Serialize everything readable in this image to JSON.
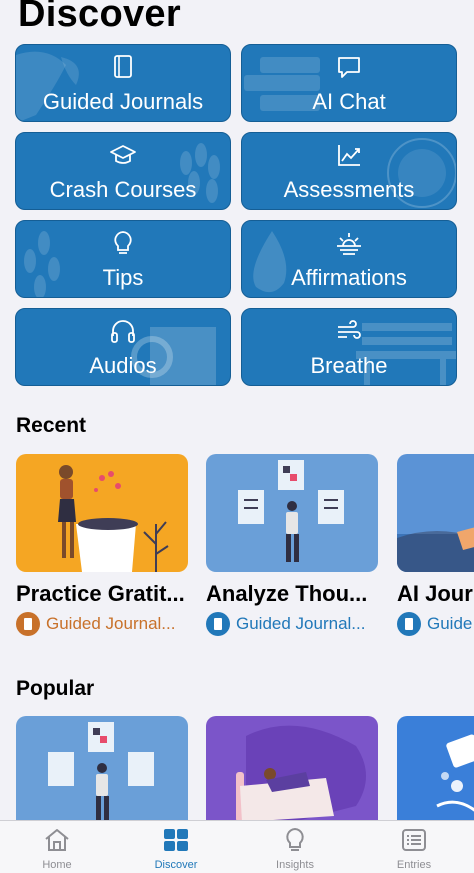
{
  "page_title": "Discover",
  "tiles": [
    {
      "label": "Guided Journals",
      "icon": "book-icon"
    },
    {
      "label": "AI Chat",
      "icon": "chat-bubble-icon"
    },
    {
      "label": "Crash Courses",
      "icon": "graduation-cap-icon"
    },
    {
      "label": "Assessments",
      "icon": "chart-trend-icon"
    },
    {
      "label": "Tips",
      "icon": "lightbulb-icon"
    },
    {
      "label": "Affirmations",
      "icon": "sunrise-icon"
    },
    {
      "label": "Audios",
      "icon": "headphones-icon"
    },
    {
      "label": "Breathe",
      "icon": "wind-icon"
    }
  ],
  "recent": {
    "title": "Recent",
    "cards": [
      {
        "title": "Practice Gratit...",
        "category": "Guided Journal...",
        "category_color": "#c8712a",
        "thumb_color": "#f5a623"
      },
      {
        "title": "Analyze Thou...",
        "category": "Guided Journal...",
        "category_color": "#2178b9",
        "thumb_color": "#6a9fd8"
      },
      {
        "title": "AI Journ",
        "category": "Guide",
        "category_color": "#2178b9",
        "thumb_color": "#5b93d6"
      }
    ]
  },
  "popular": {
    "title": "Popular",
    "thumb_colors": [
      "#6a9fd8",
      "#7b55c9",
      "#3a7fd9"
    ]
  },
  "tabbar": {
    "items": [
      {
        "label": "Home",
        "icon": "home-icon"
      },
      {
        "label": "Discover",
        "icon": "grid-icon"
      },
      {
        "label": "Insights",
        "icon": "lightbulb-icon"
      },
      {
        "label": "Entries",
        "icon": "list-icon"
      }
    ],
    "active": "Discover"
  },
  "colors": {
    "accent": "#2178b9",
    "tile": "#2178b9",
    "background": "#f2f2f7"
  }
}
